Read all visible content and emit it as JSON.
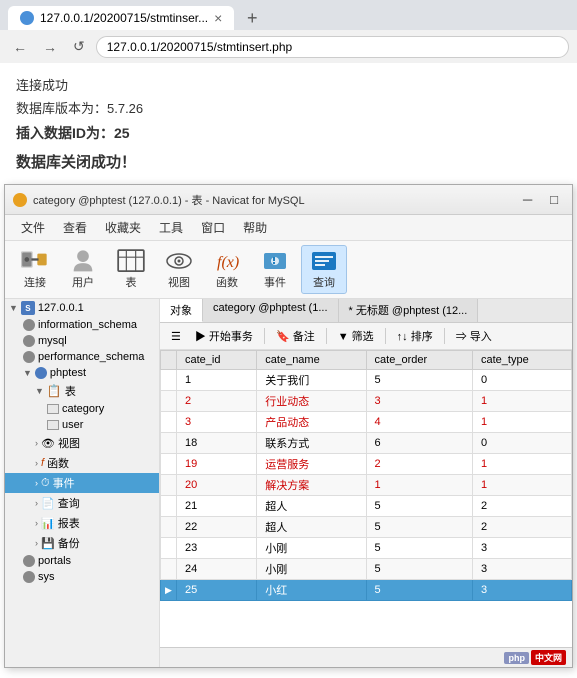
{
  "browser": {
    "tab_title": "127.0.0.1/20200715/stmtinser...",
    "tab_favicon": "globe",
    "new_tab_label": "+",
    "address": "127.0.0.1/20200715/stmtinsert.php",
    "back_label": "←",
    "forward_label": "→",
    "refresh_label": "↺"
  },
  "page": {
    "line1": "连接成功",
    "line2": "数据库版本为：5.7.26",
    "line3": "插入数据ID为：25",
    "line4": "数据库关闭成功！"
  },
  "navicat": {
    "title": "category @phptest (127.0.0.1) - 表 - Navicat for MySQL",
    "menu": [
      "文件",
      "查看",
      "收藏夹",
      "工具",
      "窗口",
      "帮助"
    ],
    "toolbar": [
      {
        "id": "connect",
        "label": "连接"
      },
      {
        "id": "user",
        "label": "用户"
      },
      {
        "id": "table",
        "label": "表"
      },
      {
        "id": "view",
        "label": "视图"
      },
      {
        "id": "function",
        "label": "函数"
      },
      {
        "id": "event",
        "label": "事件"
      },
      {
        "id": "query",
        "label": "查询",
        "active": true
      }
    ],
    "sidebar": {
      "root": "127.0.0.1",
      "items": [
        {
          "id": "information_schema",
          "label": "information_schema",
          "indent": 1,
          "type": "db"
        },
        {
          "id": "mysql",
          "label": "mysql",
          "indent": 1,
          "type": "db"
        },
        {
          "id": "performance_schema",
          "label": "performance_schema",
          "indent": 1,
          "type": "db"
        },
        {
          "id": "phptest",
          "label": "phptest",
          "indent": 1,
          "type": "db",
          "expanded": true
        },
        {
          "id": "tables",
          "label": "表",
          "indent": 2,
          "type": "folder",
          "expanded": true
        },
        {
          "id": "category",
          "label": "category",
          "indent": 3,
          "type": "table"
        },
        {
          "id": "user",
          "label": "user",
          "indent": 3,
          "type": "table"
        },
        {
          "id": "views",
          "label": "视图",
          "indent": 2,
          "type": "folder"
        },
        {
          "id": "functions",
          "label": "函数",
          "indent": 2,
          "type": "folder"
        },
        {
          "id": "events",
          "label": "事件",
          "indent": 2,
          "type": "folder",
          "active": true
        },
        {
          "id": "queries",
          "label": "查询",
          "indent": 2,
          "type": "folder"
        },
        {
          "id": "reports",
          "label": "报表",
          "indent": 2,
          "type": "folder"
        },
        {
          "id": "backup",
          "label": "备份",
          "indent": 2,
          "type": "folder"
        },
        {
          "id": "portals",
          "label": "portals",
          "indent": 1,
          "type": "db"
        },
        {
          "id": "sys",
          "label": "sys",
          "indent": 1,
          "type": "db"
        }
      ]
    },
    "content_tabs": [
      {
        "id": "objects",
        "label": "对象",
        "active": true
      },
      {
        "id": "category_table",
        "label": "category @phptest (1...",
        "active": false
      },
      {
        "id": "untitled",
        "label": "* 无标题 @phptest (12...",
        "active": false
      }
    ],
    "toolbar_actions": [
      "≡ ",
      "▶ 开始事务",
      "备注",
      "▼ 筛选",
      "↑↓ 排序",
      "导入"
    ],
    "table_headers": [
      "cate_id",
      "cate_name",
      "cate_order",
      "cate_type"
    ],
    "table_rows": [
      {
        "marker": "",
        "cate_id": "1",
        "cate_name": "关于我们",
        "cate_order": "5",
        "cate_type": "0",
        "highlight": false
      },
      {
        "marker": "",
        "cate_id": "2",
        "cate_name": "行业动态",
        "cate_order": "3",
        "cate_type": "1",
        "highlight": true
      },
      {
        "marker": "",
        "cate_id": "3",
        "cate_name": "产品动态",
        "cate_order": "4",
        "cate_type": "1",
        "highlight": true
      },
      {
        "marker": "",
        "cate_id": "18",
        "cate_name": "联系方式",
        "cate_order": "6",
        "cate_type": "0",
        "highlight": false
      },
      {
        "marker": "",
        "cate_id": "19",
        "cate_name": "运营服务",
        "cate_order": "2",
        "cate_type": "1",
        "highlight": true
      },
      {
        "marker": "",
        "cate_id": "20",
        "cate_name": "解决方案",
        "cate_order": "1",
        "cate_type": "1",
        "highlight": true
      },
      {
        "marker": "",
        "cate_id": "21",
        "cate_name": "超人",
        "cate_order": "5",
        "cate_type": "2",
        "highlight": false
      },
      {
        "marker": "",
        "cate_id": "22",
        "cate_name": "超人",
        "cate_order": "5",
        "cate_type": "2",
        "highlight": false
      },
      {
        "marker": "",
        "cate_id": "23",
        "cate_name": "小刚",
        "cate_order": "5",
        "cate_type": "3",
        "highlight": false
      },
      {
        "marker": "",
        "cate_id": "24",
        "cate_name": "小刚",
        "cate_order": "5",
        "cate_type": "3",
        "highlight": false
      },
      {
        "marker": "▶",
        "cate_id": "25",
        "cate_name": "小红",
        "cate_order": "5",
        "cate_type": "3",
        "selected": true
      }
    ],
    "status_bar_text": "php 中文网"
  }
}
